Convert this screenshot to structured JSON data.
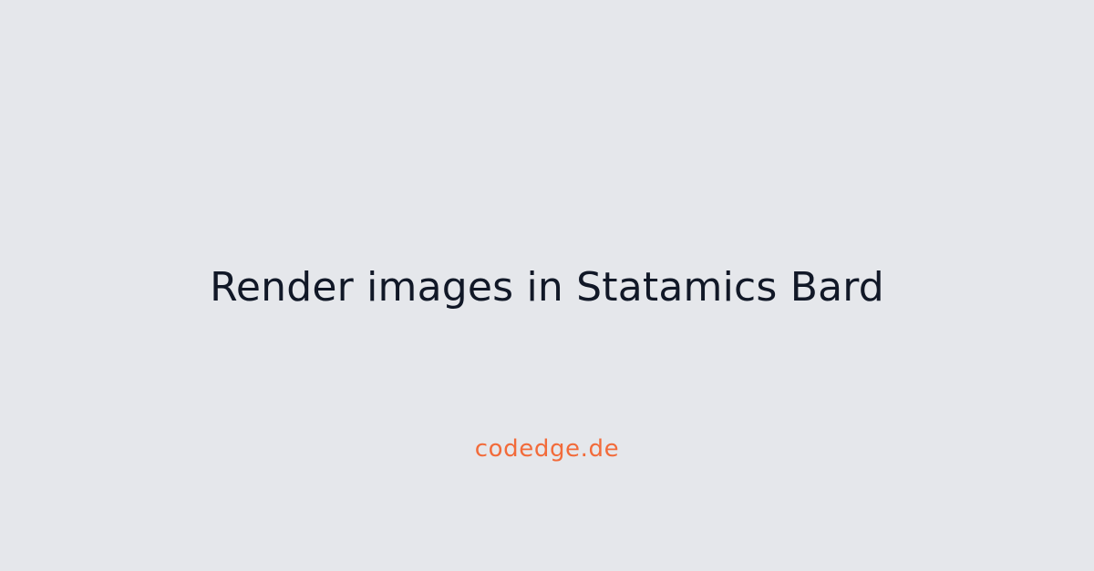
{
  "card": {
    "title": "Render images in Statamics Bard",
    "site": "codedge.de"
  },
  "colors": {
    "background": "#e5e7eb",
    "title": "#111827",
    "accent": "#f26b3a"
  }
}
